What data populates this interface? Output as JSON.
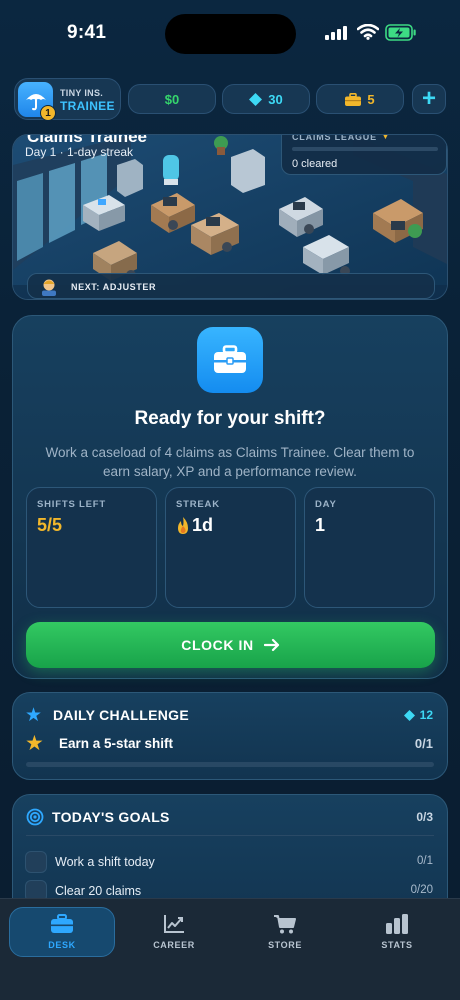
{
  "status_bar": {
    "time": "9:41"
  },
  "profile": {
    "company": "TINY INS.",
    "rank": "TRAINEE",
    "level": "1",
    "avatar_icon": "umbrella-icon"
  },
  "resources": {
    "cash": "$0",
    "gems": "30",
    "kits": "5"
  },
  "scene": {
    "title": "Claims Trainee",
    "subtitle": "Day 1 · 1-day streak",
    "league_label": "CLAIMS LEAGUE",
    "league_cleared": "0 cleared",
    "next_label": "NEXT: ADJUSTER"
  },
  "shift": {
    "title": "Ready for your shift?",
    "description": "Work a caseload of 4 claims as Claims Trainee. Clear them to earn salary, XP and a performance review.",
    "stats": [
      {
        "label": "SHIFTS LEFT",
        "value": "5/5"
      },
      {
        "label": "STREAK",
        "value": "1d"
      },
      {
        "label": "DAY",
        "value": "1"
      }
    ],
    "button_label": "CLOCK IN"
  },
  "daily_challenge": {
    "title": "DAILY CHALLENGE",
    "reward": "12",
    "task": "Earn a 5-star shift",
    "progress": "0/1",
    "progress_fraction": 0
  },
  "goals": {
    "title": "TODAY'S GOALS",
    "count": "0/3",
    "items": [
      {
        "label": "Work a shift today",
        "progress": "0/1"
      },
      {
        "label": "Clear 20 claims",
        "progress": "0/20"
      }
    ]
  },
  "nav": {
    "tabs": [
      {
        "label": "DESK",
        "icon": "briefcase-icon",
        "active": true
      },
      {
        "label": "CAREER",
        "icon": "chart-line-icon",
        "active": false
      },
      {
        "label": "STORE",
        "icon": "cart-icon",
        "active": false
      },
      {
        "label": "STATS",
        "icon": "bar-chart-icon",
        "active": false
      }
    ]
  },
  "colors": {
    "accent": "#2ea8ff",
    "cash": "#35d66c",
    "gems": "#3dd9f5",
    "gold": "#f2b72b",
    "clock_in": "#22b352"
  }
}
